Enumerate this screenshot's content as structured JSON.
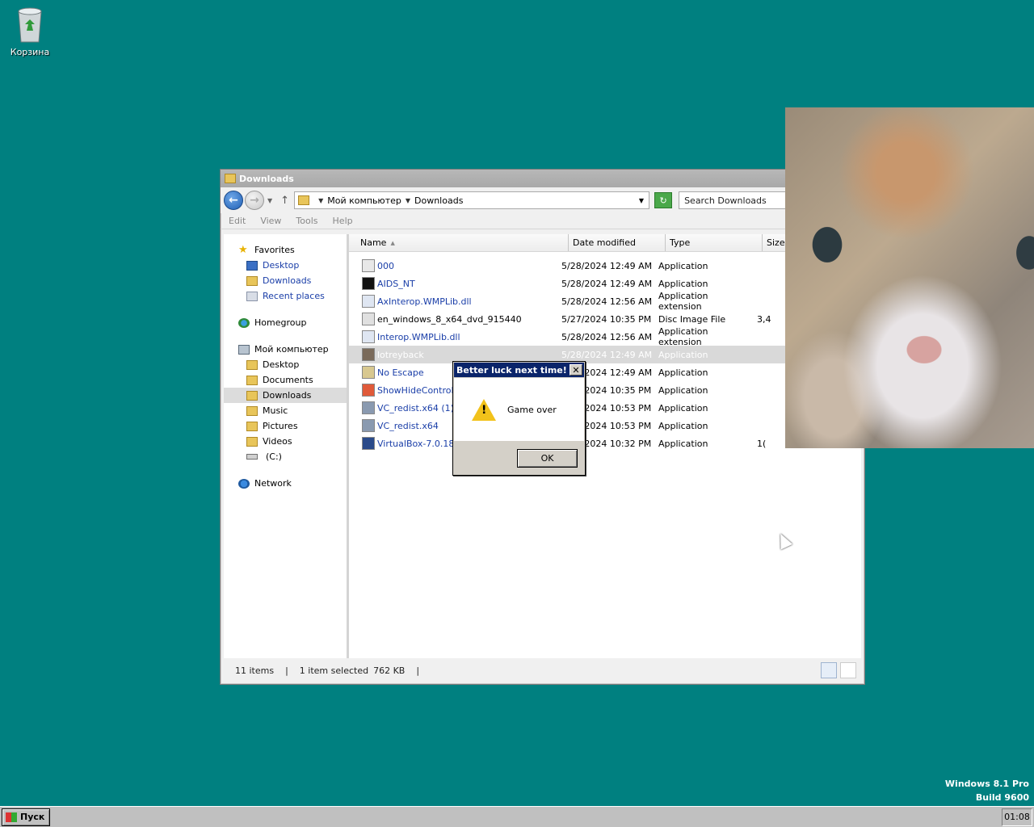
{
  "desktop": {
    "recycle_bin_label": "Корзина",
    "watermark_line1": "Windows 8.1 Pro",
    "watermark_line2": "Build 9600"
  },
  "explorer": {
    "title": "Downloads",
    "address": {
      "crumb1": "Мой компьютер",
      "crumb2": "Downloads"
    },
    "search_placeholder": "Search Downloads",
    "menu": [
      "Edit",
      "View",
      "Tools",
      "Help"
    ],
    "nav": {
      "favorites": "Favorites",
      "fav_items": [
        "Desktop",
        "Downloads",
        "Recent places"
      ],
      "homegroup": "Homegroup",
      "computer": "Мой компьютер",
      "computer_items": [
        "Desktop",
        "Documents",
        "Downloads",
        "Music",
        "Pictures",
        "Videos",
        "(C:)"
      ],
      "network": "Network"
    },
    "columns": {
      "name": "Name",
      "date": "Date modified",
      "type": "Type",
      "size": "Size"
    },
    "files": [
      {
        "name": "000",
        "date": "5/28/2024 12:49 AM",
        "type": "Application",
        "size": ""
      },
      {
        "name": "AIDS_NT",
        "date": "5/28/2024 12:49 AM",
        "type": "Application",
        "size": ""
      },
      {
        "name": "AxInterop.WMPLib.dll",
        "date": "5/28/2024 12:56 AM",
        "type": "Application extension",
        "size": ""
      },
      {
        "name": "en_windows_8_x64_dvd_915440",
        "date": "5/27/2024 10:35 PM",
        "type": "Disc Image File",
        "size": "3,4"
      },
      {
        "name": "Interop.WMPLib.dll",
        "date": "5/28/2024 12:56 AM",
        "type": "Application extension",
        "size": ""
      },
      {
        "name": "lotreyback",
        "date": "5/28/2024 12:49 AM",
        "type": "Application",
        "size": ""
      },
      {
        "name": "No Escape",
        "date": "5/28/2024 12:49 AM",
        "type": "Application",
        "size": ""
      },
      {
        "name": "ShowHideControls",
        "date": "5/27/2024 10:35 PM",
        "type": "Application",
        "size": ""
      },
      {
        "name": "VC_redist.x64 (1)",
        "date": "5/27/2024 10:53 PM",
        "type": "Application",
        "size": ""
      },
      {
        "name": "VC_redist.x64",
        "date": "5/27/2024 10:53 PM",
        "type": "Application",
        "size": ""
      },
      {
        "name": "VirtualBox-7.0.18-",
        "date": "5/27/2024 10:32 PM",
        "type": "Application",
        "size": "1("
      }
    ],
    "status": {
      "count": "11 items",
      "selected": "1 item selected",
      "size": "762 KB"
    }
  },
  "dialog": {
    "title": "Better luck next time!",
    "message": "Game over",
    "ok_label": "OK"
  },
  "taskbar": {
    "start_label": "Пуск",
    "clock": "01:08"
  }
}
